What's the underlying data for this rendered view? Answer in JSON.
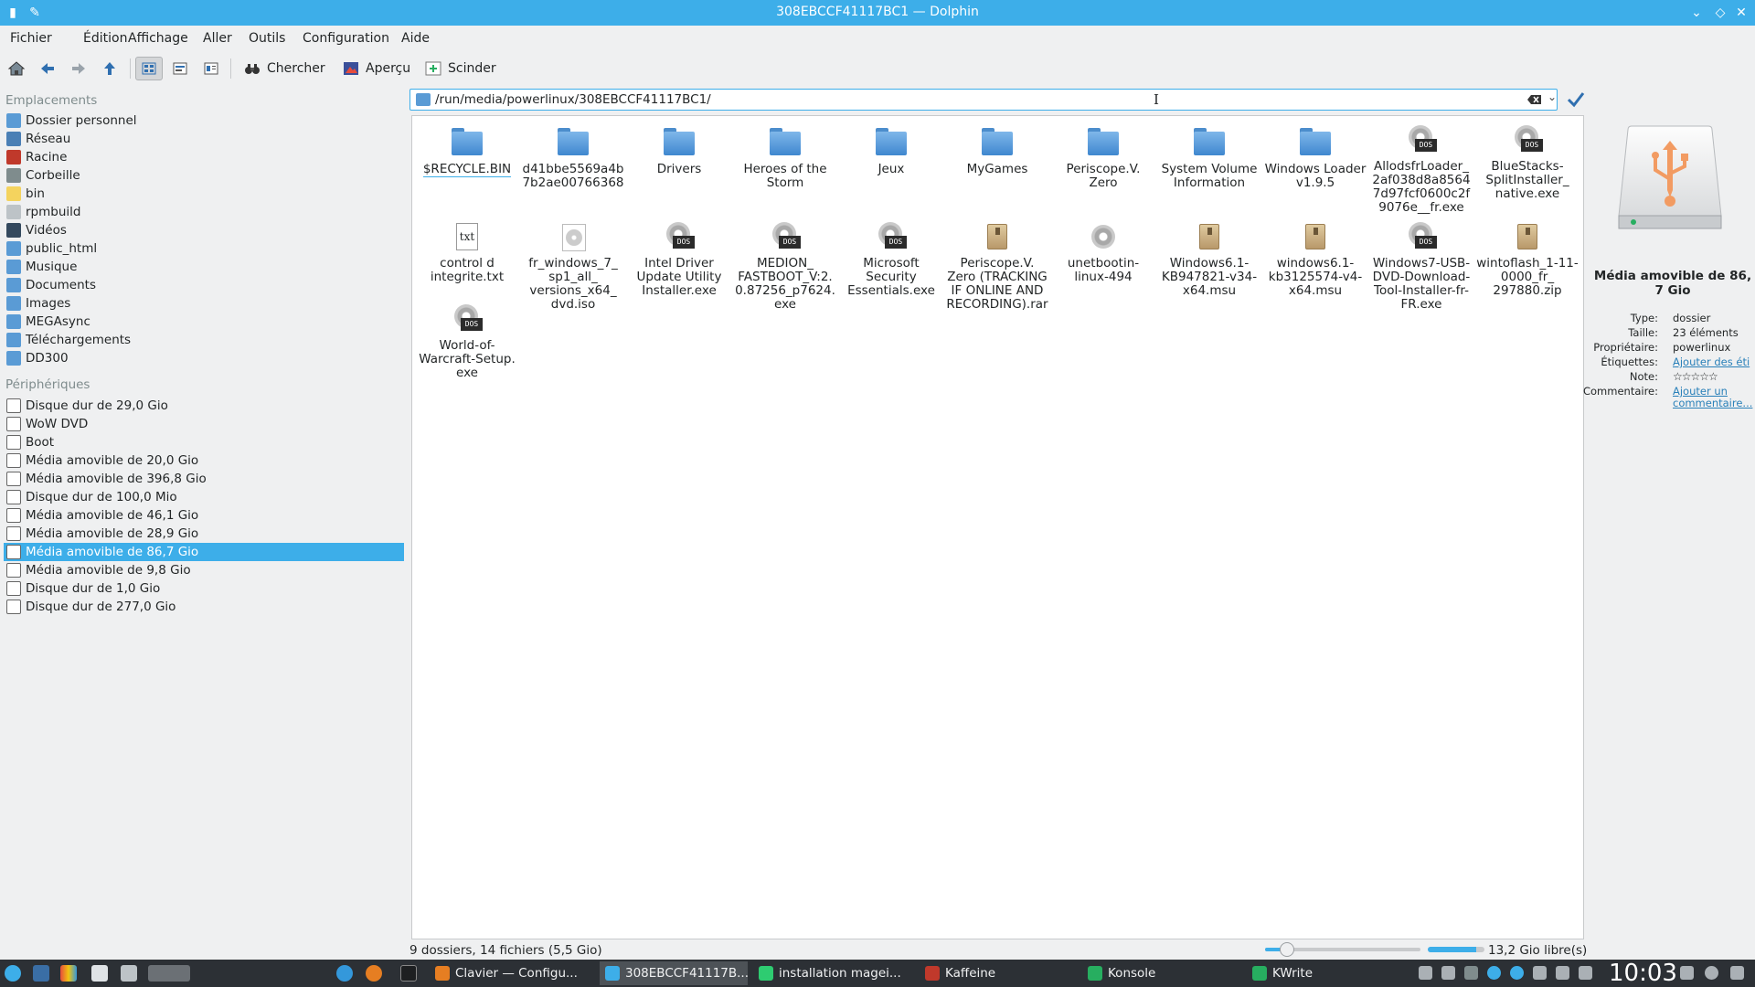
{
  "window": {
    "title": "308EBCCF41117BC1 — Dolphin"
  },
  "menu": [
    "Fichier",
    "Édition",
    "Affichage",
    "Aller",
    "Outils",
    "Configuration",
    "Aide"
  ],
  "toolbar": {
    "search": "Chercher",
    "preview": "Aperçu",
    "split": "Scinder"
  },
  "location": {
    "path": "/run/media/powerlinux/308EBCCF41117BC1/"
  },
  "sidebar": {
    "places_header": "Emplacements",
    "places": [
      {
        "label": "Dossier personnel",
        "color": "#5a9bd5"
      },
      {
        "label": "Réseau",
        "color": "#4a7fb5"
      },
      {
        "label": "Racine",
        "color": "#c0392b"
      },
      {
        "label": "Corbeille",
        "color": "#7f8c8d"
      },
      {
        "label": "bin",
        "color": "#f4d35e"
      },
      {
        "label": "rpmbuild",
        "color": "#bdc3c7"
      },
      {
        "label": "Vidéos",
        "color": "#34495e"
      },
      {
        "label": "public_html",
        "color": "#5a9bd5"
      },
      {
        "label": "Musique",
        "color": "#5a9bd5"
      },
      {
        "label": "Documents",
        "color": "#5a9bd5"
      },
      {
        "label": "Images",
        "color": "#5a9bd5"
      },
      {
        "label": "MEGAsync",
        "color": "#5a9bd5"
      },
      {
        "label": "Téléchargements",
        "color": "#5a9bd5"
      },
      {
        "label": "DD300",
        "color": "#5a9bd5"
      }
    ],
    "devices_header": "Périphériques",
    "devices": [
      "Disque dur de 29,0 Gio",
      "WoW DVD",
      "Boot",
      "Média amovible de 20,0 Gio",
      "Média amovible de 396,8 Gio",
      "Disque dur de 100,0 Mio",
      "Média amovible de 46,1 Gio",
      "Média amovible de 28,9 Gio",
      "Média amovible de 86,7 Gio",
      "Média amovible de 9,8 Gio",
      "Disque dur de 1,0 Gio",
      "Disque dur de 277,0 Gio"
    ],
    "selected_device": 8
  },
  "files": [
    {
      "name": "$RECYCLE.BIN",
      "icon": "folder-icon"
    },
    {
      "name": "d41bbe5569a4b 7b2ae00766368",
      "icon": "folder-icon"
    },
    {
      "name": "Drivers",
      "icon": "folder-icon"
    },
    {
      "name": "Heroes of the Storm",
      "icon": "folder-icon"
    },
    {
      "name": "Jeux",
      "icon": "folder-icon"
    },
    {
      "name": "MyGames",
      "icon": "folder-icon"
    },
    {
      "name": "Periscope.V. Zero",
      "icon": "folder-icon"
    },
    {
      "name": "System Volume Information",
      "icon": "folder-icon"
    },
    {
      "name": "Windows Loader v1.9.5",
      "icon": "folder-icon"
    },
    {
      "name": "AllodsfrLoader_ 2af038d8a8564 7d97fcf0600c2f 9076e__fr.exe",
      "icon": "exe-icon"
    },
    {
      "name": "BlueStacks- SplitInstaller_ native.exe",
      "icon": "exe-icon"
    },
    {
      "name": "control d integrite.txt",
      "icon": "text-file-icon"
    },
    {
      "name": "fr_windows_7_ sp1_all_ versions_x64_ dvd.iso",
      "icon": "disc-image-icon"
    },
    {
      "name": "Intel Driver Update Utility Installer.exe",
      "icon": "exe-icon"
    },
    {
      "name": "MEDION_ FASTBOOT_V:2. 0.87256_p7624. exe",
      "icon": "exe-icon"
    },
    {
      "name": "Microsoft Security Essentials.exe",
      "icon": "exe-icon"
    },
    {
      "name": "Periscope.V. Zero (TRACKING IF ONLINE AND RECORDING).rar",
      "icon": "archive-icon"
    },
    {
      "name": "unetbootin- linux-494",
      "icon": "executable-gear-icon"
    },
    {
      "name": "Windows6.1- KB947821-v34- x64.msu",
      "icon": "package-icon"
    },
    {
      "name": "windows6.1- kb3125574-v4- x64.msu",
      "icon": "package-icon"
    },
    {
      "name": "Windows7-USB- DVD-Download- Tool-Installer-fr- FR.exe",
      "icon": "exe-icon"
    },
    {
      "name": "wintoflash_1-11- 0000_fr_ 297880.zip",
      "icon": "zip-icon"
    },
    {
      "name": "World-of- Warcraft-Setup. exe",
      "icon": "exe-icon"
    }
  ],
  "info": {
    "title": "Média amovible de 86, 7 Gio",
    "type_label": "Type:",
    "type_value": "dossier",
    "size_label": "Taille:",
    "size_value": "23 éléments",
    "owner_label": "Propriétaire:",
    "owner_value": "powerlinux",
    "tags_label": "Étiquettes:",
    "tags_value": "Ajouter des éti",
    "rating_label": "Note:",
    "rating_value": "☆☆☆☆☆",
    "comment_label": "Commentaire:",
    "comment_value_1": "Ajouter un",
    "comment_value_2": "commentaire..."
  },
  "status": {
    "summary": "9 dossiers, 14 fichiers (5,5 Gio)",
    "free_space": "13,2 Gio libre(s)",
    "used_fraction": 0.85
  },
  "taskbar": {
    "tasks": [
      {
        "label": "Clavier — Configu...",
        "active": false
      },
      {
        "label": "308EBCCF41117B...",
        "active": true
      },
      {
        "label": "installation magei...",
        "active": false
      },
      {
        "label": "Kaffeine",
        "active": false
      },
      {
        "label": "Konsole",
        "active": false
      },
      {
        "label": "KWrite",
        "active": false
      }
    ],
    "clock": "10:03"
  }
}
